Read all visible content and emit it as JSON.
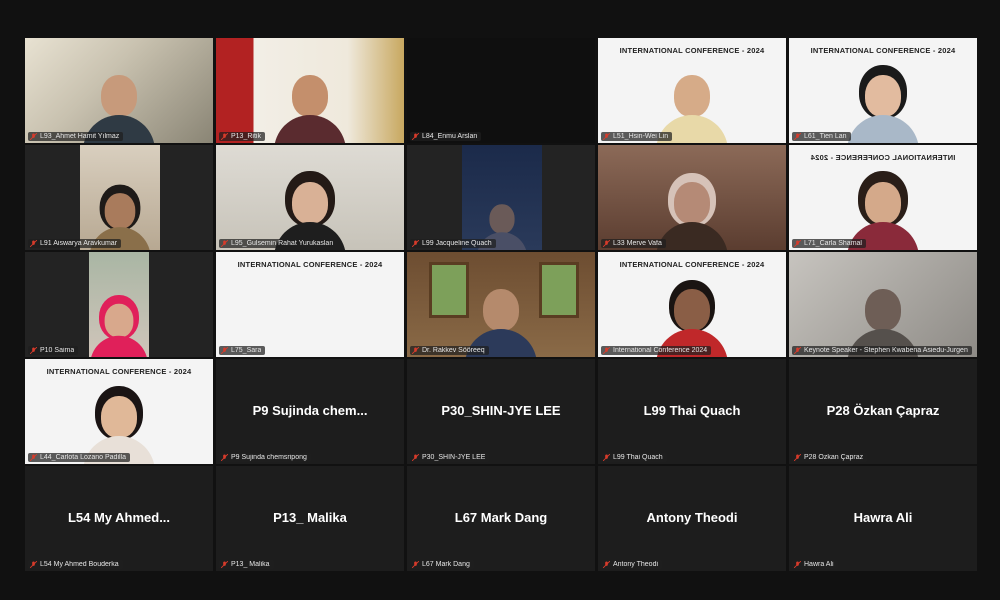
{
  "tiles": [
    {
      "name": "L93_Ahmet Hamit Yılmaz"
    },
    {
      "name": "P13_Ritik"
    },
    {
      "name": "L84_Enmu Arslan"
    },
    {
      "name": "L51_Hsin-Wei Lin",
      "banner": "INTERNATIONAL CONFERENCE - 2024"
    },
    {
      "name": "L61_Tien Lan",
      "banner": "INTERNATIONAL CONFERENCE - 2024"
    },
    {
      "name": "L91 Aiswarya Aravkumar"
    },
    {
      "name": "L95_Gulsemin Rahat Yurukaslan"
    },
    {
      "name": "L99 Jacqueline Quach"
    },
    {
      "name": "L33 Merve Vafa"
    },
    {
      "name": "L71_Carla Shamal",
      "banner": "INTERNATIONAL CONFERENCE - 2024"
    },
    {
      "name": "P10 Saima"
    },
    {
      "name": "L75_Sara",
      "banner": "INTERNATIONAL CONFERENCE - 2024"
    },
    {
      "name": "Dr. Rakkev Sööreeq"
    },
    {
      "name": "International Conference 2024",
      "banner": "INTERNATIONAL CONFERENCE - 2024"
    },
    {
      "name": "Keynote Speaker - Stephen Kwabena Asiedu-Jurgen"
    },
    {
      "name": "L44_Carlota Lozano Padilla",
      "banner": "INTERNATIONAL CONFERENCE - 2024"
    },
    {
      "display": "P9 Sujinda chem...",
      "name": "P9 Sujinda chemsripong"
    },
    {
      "display": "P30_SHIN-JYE LEE",
      "name": "P30_SHIN-JYE LEE"
    },
    {
      "display": "L99 Thai Quach",
      "name": "L99 Thai Quach"
    },
    {
      "display": "P28 Özkan Çapraz",
      "name": "P28 Özkan Çapraz"
    },
    {
      "display": "L54 My Ahmed...",
      "name": "L54 My Ahmed Bouderka"
    },
    {
      "display": "P13_ Malika",
      "name": "P13_ Malika"
    },
    {
      "display": "L67 Mark Dang",
      "name": "L67 Mark Dang"
    },
    {
      "display": "Antony Theodi",
      "name": "Antony Theodi"
    },
    {
      "display": "Hawra Ali",
      "name": "Hawra Ali"
    }
  ],
  "colors": {
    "background": "#111111",
    "tile": "#1d1d1d",
    "mic_muted": "#d83b2b"
  },
  "icons": {
    "muted_mic": "mic-muted-icon"
  }
}
